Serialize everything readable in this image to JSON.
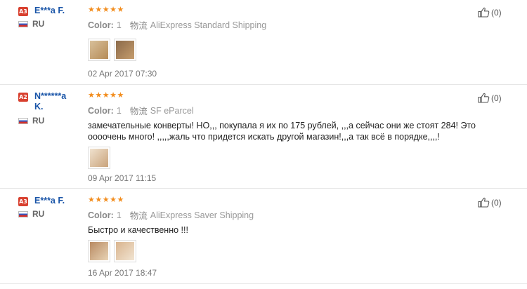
{
  "labels": {
    "color": "Color:",
    "logistics": "物流"
  },
  "reviews": [
    {
      "level": "A3",
      "name": "E***a F.",
      "country": "RU",
      "stars": "★★★★★",
      "color_value": "1",
      "shipping": "AliExpress Standard Shipping",
      "text": "",
      "photos": [
        {
          "name": "photo-envelope-beige",
          "colors": [
            "#d8c09a",
            "#b58a55"
          ]
        },
        {
          "name": "photo-envelope-brown",
          "colors": [
            "#8b6a4a",
            "#c59c6c"
          ]
        }
      ],
      "date": "02 Apr 2017 07:30",
      "helpful_count": "(0)"
    },
    {
      "level": "A2",
      "name": "N******a K.",
      "country": "RU",
      "stars": "★★★★★",
      "color_value": "1",
      "shipping": "SF eParcel",
      "text": "замечательные конверты! НО,,, покупала я их по 175 рублей, ,,,а сейчас они же стоят 284! Это оооочень много! ,,,,,жаль что придется искать другой магазин!,,,а так всё в порядке,,,,!",
      "photos": [
        {
          "name": "photo-envelope-stack",
          "colors": [
            "#f0e2cf",
            "#c9a37b"
          ]
        }
      ],
      "date": "09 Apr 2017 11:15",
      "helpful_count": "(0)"
    },
    {
      "level": "A3",
      "name": "E***a F.",
      "country": "RU",
      "stars": "★★★★★",
      "color_value": "1",
      "shipping": "AliExpress Saver Shipping",
      "text": "Быстро и качественно !!!",
      "photos": [
        {
          "name": "photo-envelope-kraft",
          "colors": [
            "#b88a62",
            "#e8d3b5"
          ]
        },
        {
          "name": "photo-envelope-light",
          "colors": [
            "#d9b48e",
            "#f1e4d2"
          ]
        }
      ],
      "date": "16 Apr 2017 18:47",
      "helpful_count": "(0)"
    }
  ]
}
